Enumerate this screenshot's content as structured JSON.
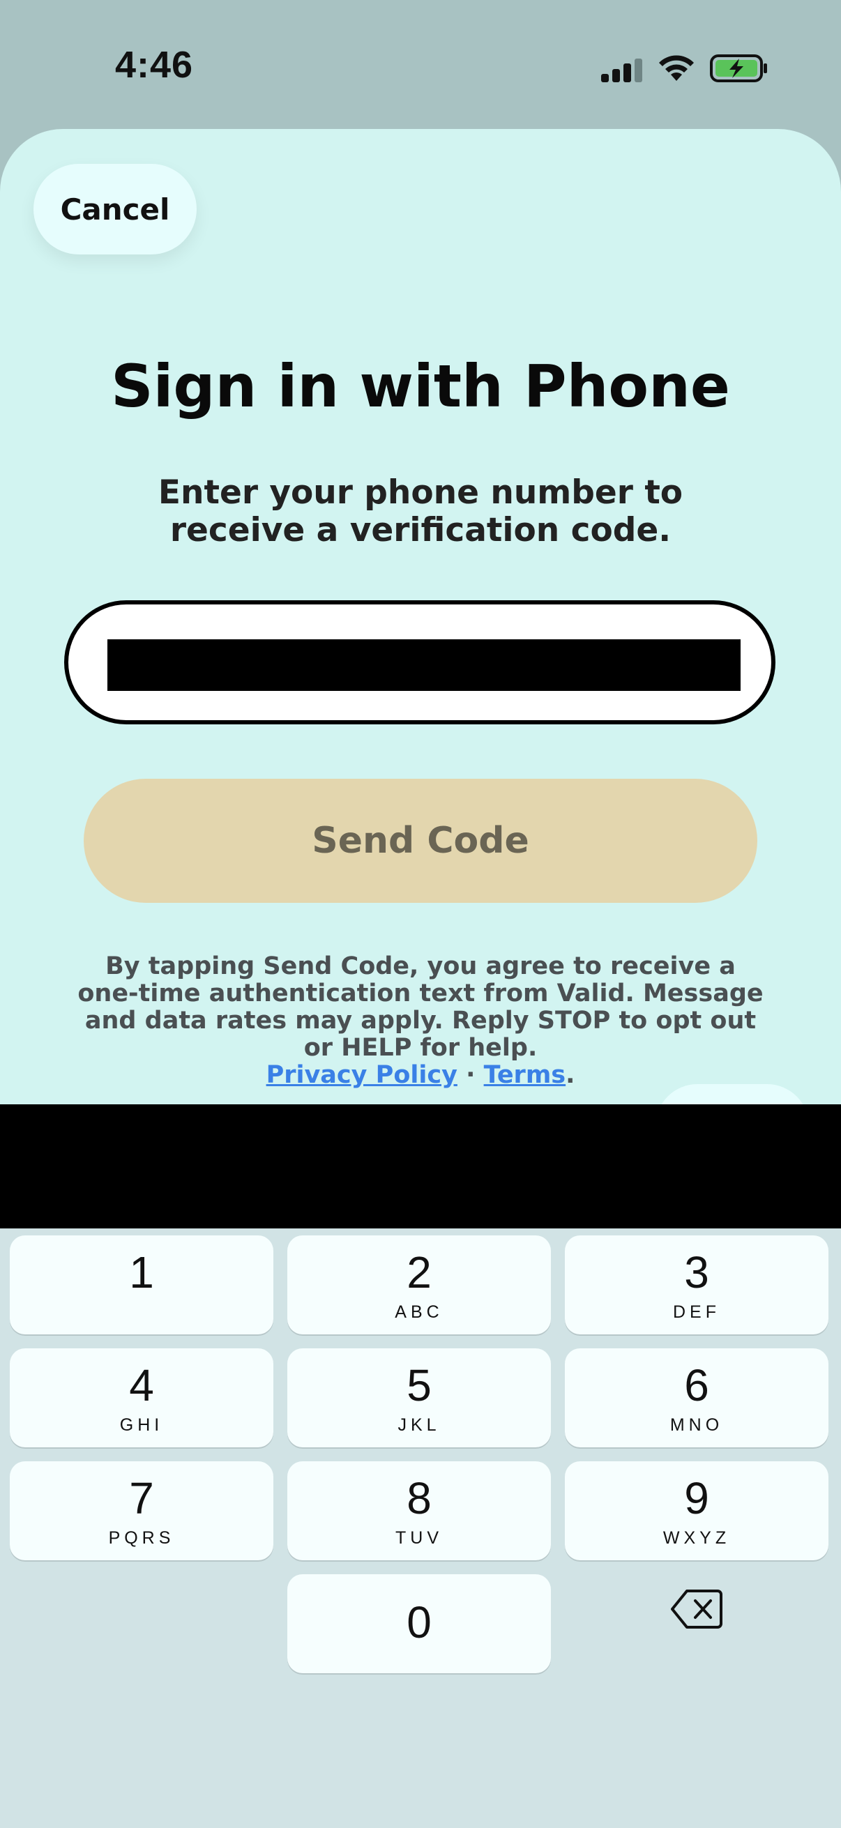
{
  "status_bar": {
    "time": "4:46"
  },
  "sheet": {
    "cancel_label": "Cancel",
    "title": "Sign in with Phone",
    "subtitle": "Enter your phone number to receive a verification code.",
    "phone_input": {
      "value": "",
      "placeholder": ""
    },
    "send_label": "Send Code",
    "disclaimer": {
      "text": "By tapping Send Code, you agree to receive a one-time authentication text from Valid. Message and data rates may apply. Reply STOP to opt out or HELP for help.",
      "privacy_link": "Privacy Policy",
      "separator": "·",
      "terms_link": "Terms",
      "end": "."
    }
  },
  "keypad": {
    "keys": [
      {
        "num": "1",
        "letters": ""
      },
      {
        "num": "2",
        "letters": "ABC"
      },
      {
        "num": "3",
        "letters": "DEF"
      },
      {
        "num": "4",
        "letters": "GHI"
      },
      {
        "num": "5",
        "letters": "JKL"
      },
      {
        "num": "6",
        "letters": "MNO"
      },
      {
        "num": "7",
        "letters": "PQRS"
      },
      {
        "num": "8",
        "letters": "TUV"
      },
      {
        "num": "9",
        "letters": "WXYZ"
      },
      {
        "num": "0",
        "letters": ""
      }
    ],
    "delete_icon": "delete-backspace-icon"
  },
  "colors": {
    "sheet_bg": "#d2f4f1",
    "send_button_bg": "#e3d6ae",
    "link": "#3a80e6",
    "keypad_bg": "#d1e3e5"
  }
}
